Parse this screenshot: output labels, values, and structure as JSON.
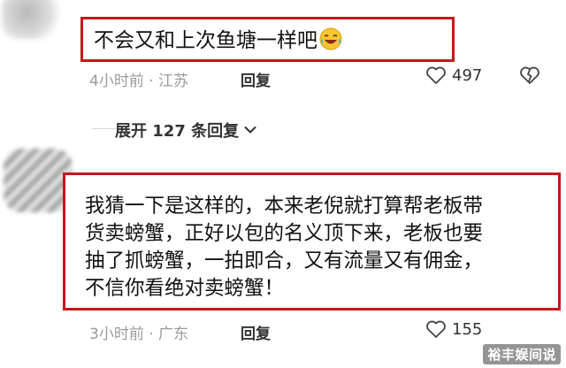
{
  "comments": [
    {
      "text": "不会又和上次鱼塘一样吧",
      "emoji_icon": "laughing-tears-emoji-icon",
      "meta": "4小时前 · 江苏",
      "reply_label": "回复",
      "likes": "497"
    },
    {
      "lines": [
        "我猜一下是这样的，本来老倪就打算帮老板带",
        "货卖螃蟹，正好以包的名义顶下来，老板也要",
        "抽了抓螃蟹，一拍即合，又有流量又有佣金，",
        "不信你看绝对卖螃蟹！"
      ],
      "meta": "3小时前 · 广东",
      "reply_label": "回复",
      "likes": "155"
    }
  ],
  "expand_replies": {
    "label": "展开 127 条回复",
    "icon": "chevron-down-icon"
  },
  "watermark": "裕丰娱间说",
  "colors": {
    "highlight_border": "#c8141c",
    "meta_gray": "#9a9a9a",
    "text_dark": "#111111"
  }
}
